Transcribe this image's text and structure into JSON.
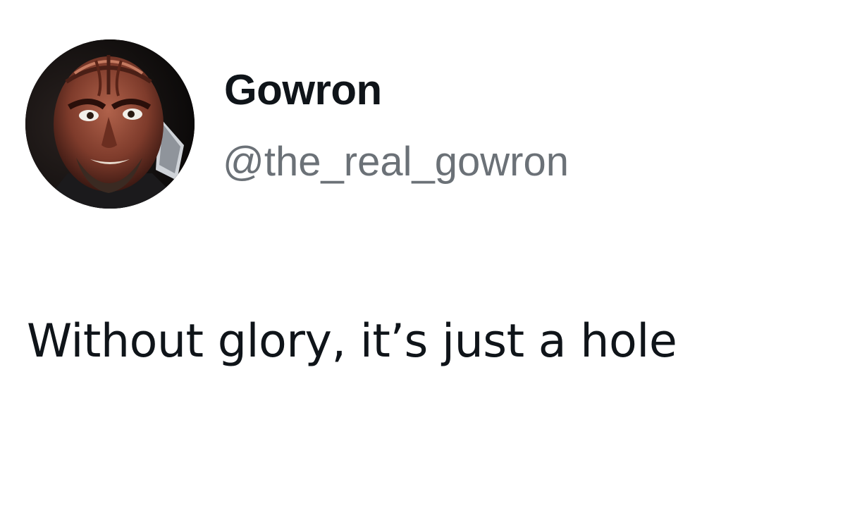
{
  "tweet": {
    "display_name": "Gowron",
    "handle": "@the_real_gowron",
    "text": "Without glory, it’s just a hole",
    "avatar_icon": "klingon-portrait-avatar"
  },
  "colors": {
    "background": "#ffffff",
    "name": "#0f1419",
    "handle": "#6b7177",
    "text": "#0f1419"
  }
}
